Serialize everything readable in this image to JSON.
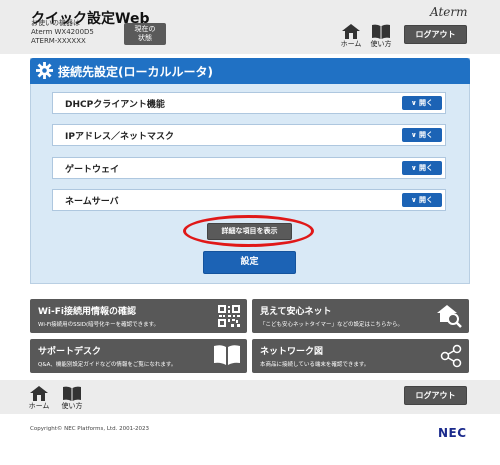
{
  "header": {
    "app_title": "クイック設定Web",
    "device_label": "お使いの機器は",
    "device_model": "Aterm WX4200D5",
    "device_name": "ATERM-XXXXXX",
    "status_button": [
      "現在の",
      "状態"
    ],
    "brand": "Aterm",
    "home_label": "ホーム",
    "help_label": "使い方",
    "logout_label": "ログアウト"
  },
  "panel": {
    "title": "接続先設定(ローカルルータ)",
    "open_label": "∨ 開く",
    "sections": [
      {
        "label": "DHCPクライアント機能"
      },
      {
        "label": "IPアドレス／ネットマスク"
      },
      {
        "label": "ゲートウェイ"
      },
      {
        "label": "ネームサーバ"
      }
    ],
    "detail_button": "詳細な項目を表示",
    "submit_button": "設定"
  },
  "tiles": [
    {
      "title": "Wi-Fi接続用情報の確認",
      "desc": "Wi-Fi接続用のSSID(暗号化キーを確認できます。",
      "icon": "qr-code-icon"
    },
    {
      "title": "見えて安心ネット",
      "desc": "「こども安心ネットタイマー」などの設定はこちらから。",
      "icon": "home-search-icon"
    },
    {
      "title": "サポートデスク",
      "desc": "Q&A、機能別設定ガイドなどの情報をご覧になれます。",
      "icon": "book-icon"
    },
    {
      "title": "ネットワーク図",
      "desc": "本商品に接続している端末を確認できます。",
      "icon": "network-share-icon"
    }
  ],
  "footer": {
    "home_label": "ホーム",
    "help_label": "使い方",
    "logout_label": "ログアウト",
    "copyright": "Copyright© NEC Platforms, Ltd. 2001-2023",
    "vendor": "NEC"
  },
  "colors": {
    "accent_blue": "#1c63b5",
    "dark_button": "#585858",
    "highlight_red": "#e01818"
  }
}
